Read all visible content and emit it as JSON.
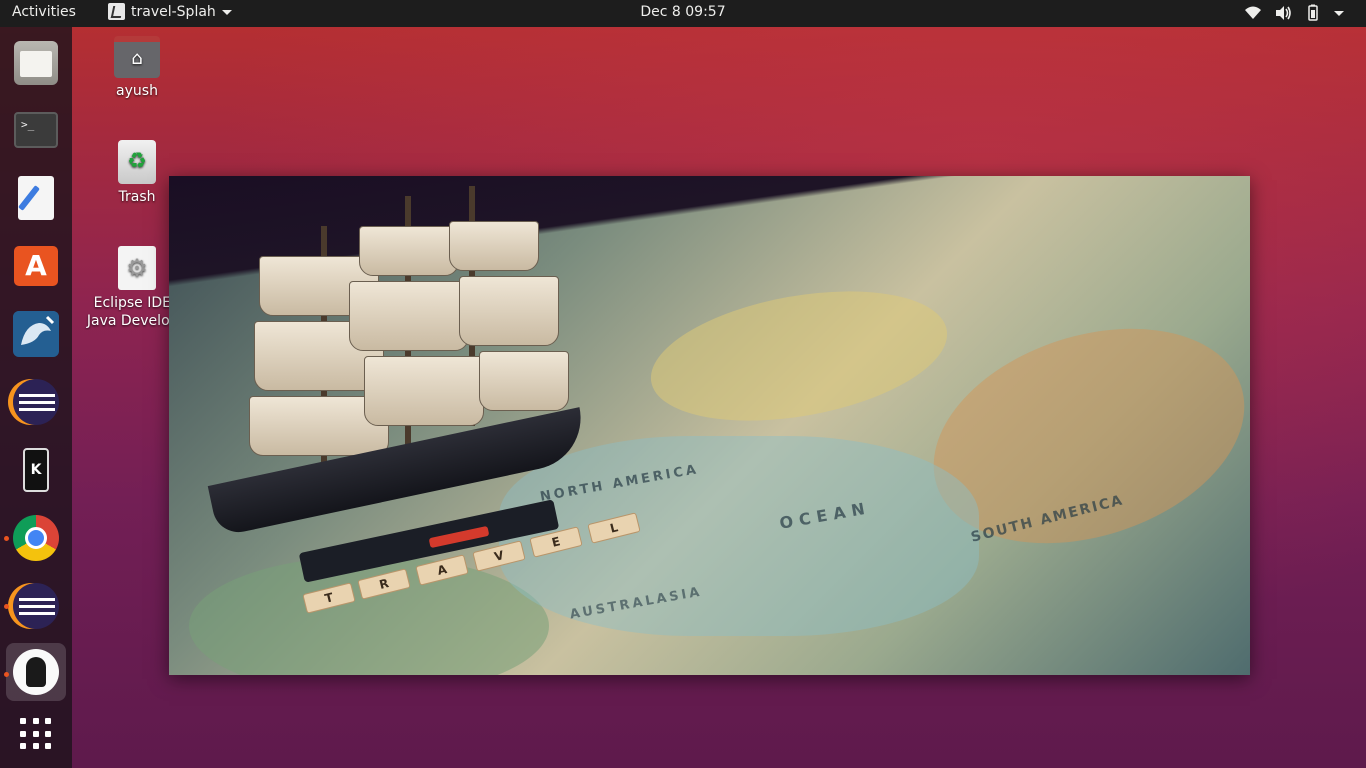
{
  "topbar": {
    "activities": "Activities",
    "app_name": "travel-Splah",
    "clock": "Dec 8  09:57",
    "tray_icons": [
      "wifi-icon",
      "volume-icon",
      "battery-icon",
      "system-menu-caret-icon"
    ]
  },
  "dock": {
    "items": [
      {
        "name": "files",
        "icon": "files-icon",
        "running": false,
        "active": false
      },
      {
        "name": "terminal",
        "icon": "terminal-icon",
        "running": false,
        "active": false
      },
      {
        "name": "text-editor",
        "icon": "text-editor-icon",
        "running": false,
        "active": false
      },
      {
        "name": "ubuntu-software",
        "icon": "ubuntu-software-icon",
        "running": false,
        "active": false
      },
      {
        "name": "mysql-workbench",
        "icon": "mysql-workbench-icon",
        "running": false,
        "active": false
      },
      {
        "name": "eclipse",
        "icon": "eclipse-icon",
        "running": false,
        "active": false
      },
      {
        "name": "kde-connect",
        "icon": "kde-connect-icon",
        "running": false,
        "active": false
      },
      {
        "name": "google-chrome",
        "icon": "chrome-icon",
        "running": true,
        "active": false
      },
      {
        "name": "eclipse-running",
        "icon": "eclipse-icon",
        "running": true,
        "active": false
      },
      {
        "name": "java-app",
        "icon": "java-duke-icon",
        "running": true,
        "active": true
      }
    ],
    "show_apps_icon": "show-applications-icon",
    "terminal_glyph": ">_",
    "store_glyph": "A",
    "kde_glyph": "K"
  },
  "desktop": {
    "icons": [
      {
        "label": "ayush",
        "icon": "home-folder-icon"
      },
      {
        "label": "Trash",
        "icon": "trash-icon"
      },
      {
        "label_line1": "Eclipse IDE f",
        "label_line2": "Java Develope",
        "icon": "eclipse-launcher-icon"
      }
    ],
    "trash_glyph": "♻",
    "gear_glyph": "⚙"
  },
  "splash": {
    "tiles": [
      "T",
      "R",
      "A",
      "V",
      "E",
      "L"
    ],
    "map_text_1": "NORTH AMERICA",
    "map_text_2": "OCEAN",
    "map_text_3": "SOUTH AMERICA",
    "map_text_4": "AUSTRALASIA"
  },
  "colors": {
    "topbar": "#1d1d1d",
    "accent": "#e95420",
    "wallpaper_top": "#b8302f",
    "wallpaper_bottom": "#5e1a4c"
  }
}
